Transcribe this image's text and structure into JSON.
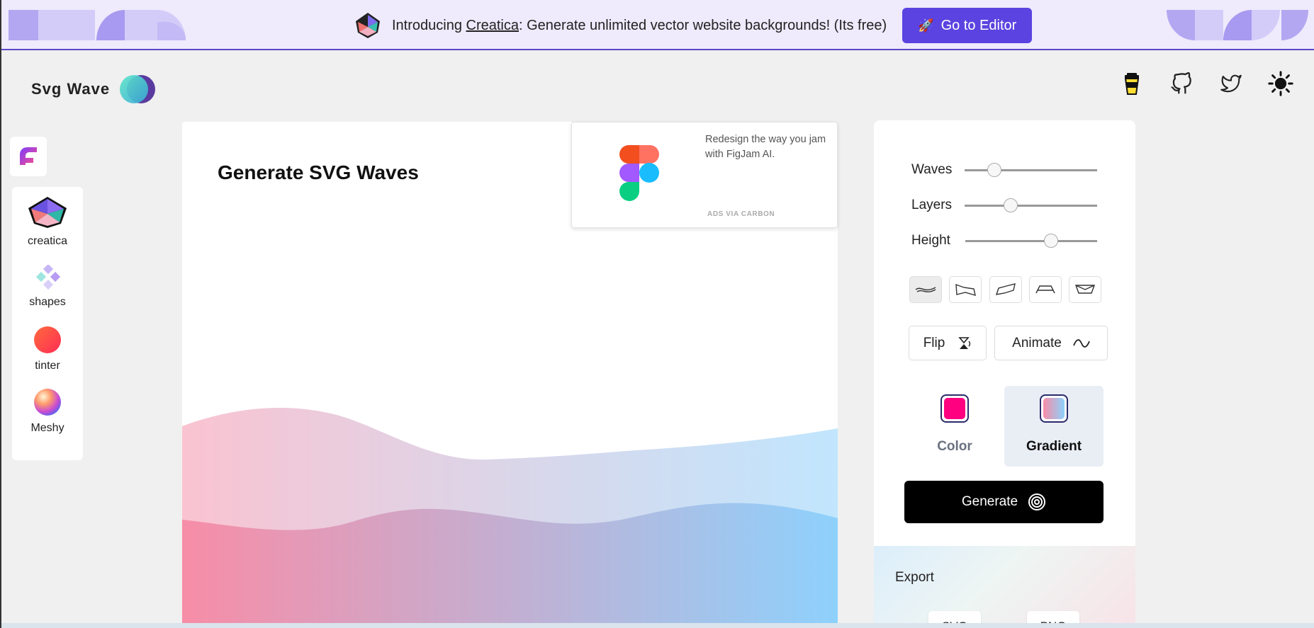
{
  "banner": {
    "text_before": "Introducing ",
    "link_text": "Creatica",
    "text_after": ": Generate unlimited vector website backgrounds! (Its free)",
    "button_label": "Go to Editor",
    "button_icon": "rocket-icon"
  },
  "brand": {
    "name": "Svg Wave"
  },
  "nav": {
    "icons": [
      "coffee-cup-icon",
      "github-icon",
      "twitter-icon",
      "sun-icon"
    ]
  },
  "sidebar": {
    "items": [
      {
        "label": "creatica"
      },
      {
        "label": "shapes"
      },
      {
        "label": "tinter"
      },
      {
        "label": "Meshy"
      }
    ]
  },
  "main": {
    "title": "Generate SVG Waves"
  },
  "ad": {
    "text": "Redesign the way you jam with FigJam AI.",
    "via": "ADS VIA CARBON"
  },
  "controls": {
    "sliders": [
      {
        "label": "Waves",
        "value": 0.19
      },
      {
        "label": "Layers",
        "value": 0.35
      },
      {
        "label": "Height",
        "value": 0.65
      }
    ],
    "shapes": [
      "smooth-wave-icon",
      "step-wave-icon",
      "peak-wave-icon",
      "flat-top-wave-icon",
      "bowl-wave-icon"
    ],
    "flip_label": "Flip",
    "animate_label": "Animate",
    "fill_options": [
      {
        "label": "Color",
        "selected": false
      },
      {
        "label": "Gradient",
        "selected": true
      }
    ],
    "generate_label": "Generate"
  },
  "export": {
    "title": "Export",
    "buttons": [
      "SVG",
      "PNG"
    ]
  },
  "colors": {
    "accent": "#5a43e0",
    "color_swatch": "#ff0080",
    "gradient_start": "#f78da7",
    "gradient_end": "#8ed1fc"
  }
}
